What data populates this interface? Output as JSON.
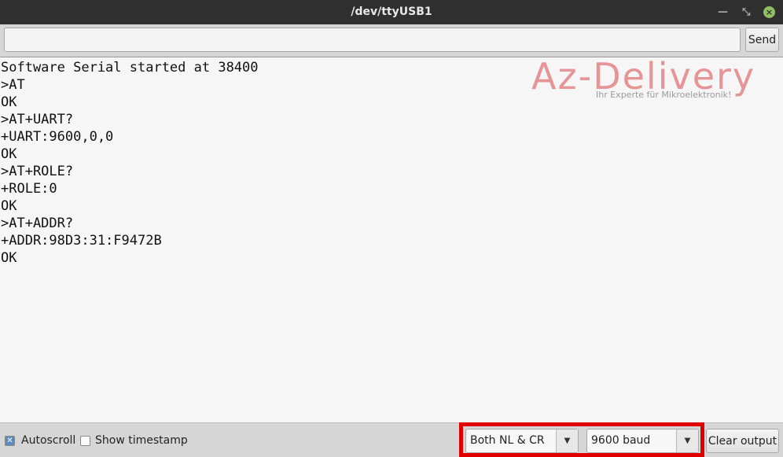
{
  "window": {
    "title": "/dev/ttyUSB1",
    "minimize_icon": "minimize-icon",
    "maximize_icon": "maximize-icon",
    "close_icon": "close-icon"
  },
  "input": {
    "value": "",
    "send_label": "Send"
  },
  "output": {
    "lines": [
      "Software Serial started at 38400",
      ">AT",
      "OK",
      ">AT+UART?",
      "+UART:9600,0,0",
      "OK",
      ">AT+ROLE?",
      "+ROLE:0",
      "OK",
      ">AT+ADDR?",
      "+ADDR:98D3:31:F9472B",
      "OK"
    ]
  },
  "logo": {
    "brand": "Az-Delivery",
    "tagline": "Ihr Experte für Mikroelektronik!",
    "color": "#e59596"
  },
  "bottom": {
    "autoscroll_label": "Autoscroll",
    "autoscroll_checked": true,
    "timestamp_label": "Show timestamp",
    "timestamp_checked": false,
    "line_ending": "Both NL & CR",
    "baud": "9600 baud",
    "clear_label": "Clear output",
    "highlight_color": "#e00000"
  }
}
